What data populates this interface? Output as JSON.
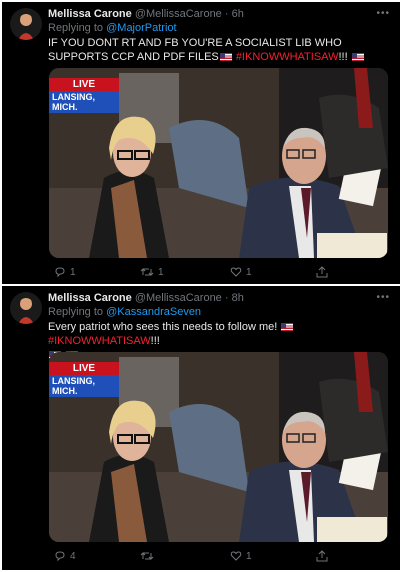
{
  "tweets": [
    {
      "name": "Mellissa Carone",
      "handle": "@MellissaCarone",
      "sep": "·",
      "time": "6h",
      "more": "•••",
      "reply_prefix": "Replying to",
      "reply_to": "@MajorPatriot",
      "text_main": "IF YOU DONT RT AND FB YOU'RE A SOCIALIST LIB WHO SUPPORTS CCP AND PDF FILES",
      "hashtag": "#IKNOWWHATISAW",
      "exclaim": "!!!",
      "media": {
        "live": "LIVE",
        "location": "LANSING, MICH."
      },
      "replies": "1",
      "retweets": "1",
      "likes": "1"
    },
    {
      "name": "Mellissa Carone",
      "handle": "@MellissaCarone",
      "sep": "·",
      "time": "8h",
      "more": "•••",
      "reply_prefix": "Replying to",
      "reply_to": "@KassandraSeven",
      "text_main": "Every patriot who sees this needs to follow me!",
      "hashtag": "#IKNOWWHATISAW",
      "exclaim": "!!!",
      "media": {
        "live": "LIVE",
        "location": "LANSING, MICH."
      },
      "replies": "4",
      "retweets": "",
      "likes": "1"
    }
  ],
  "icons": [
    "avatar",
    "more-icon",
    "us-flag-icon",
    "reply-icon",
    "retweet-icon",
    "like-icon",
    "share-icon"
  ],
  "colors": {
    "background": "#000000",
    "mention": "#1d9bf0",
    "hashtag": "#f4212e",
    "muted": "#71767b"
  }
}
